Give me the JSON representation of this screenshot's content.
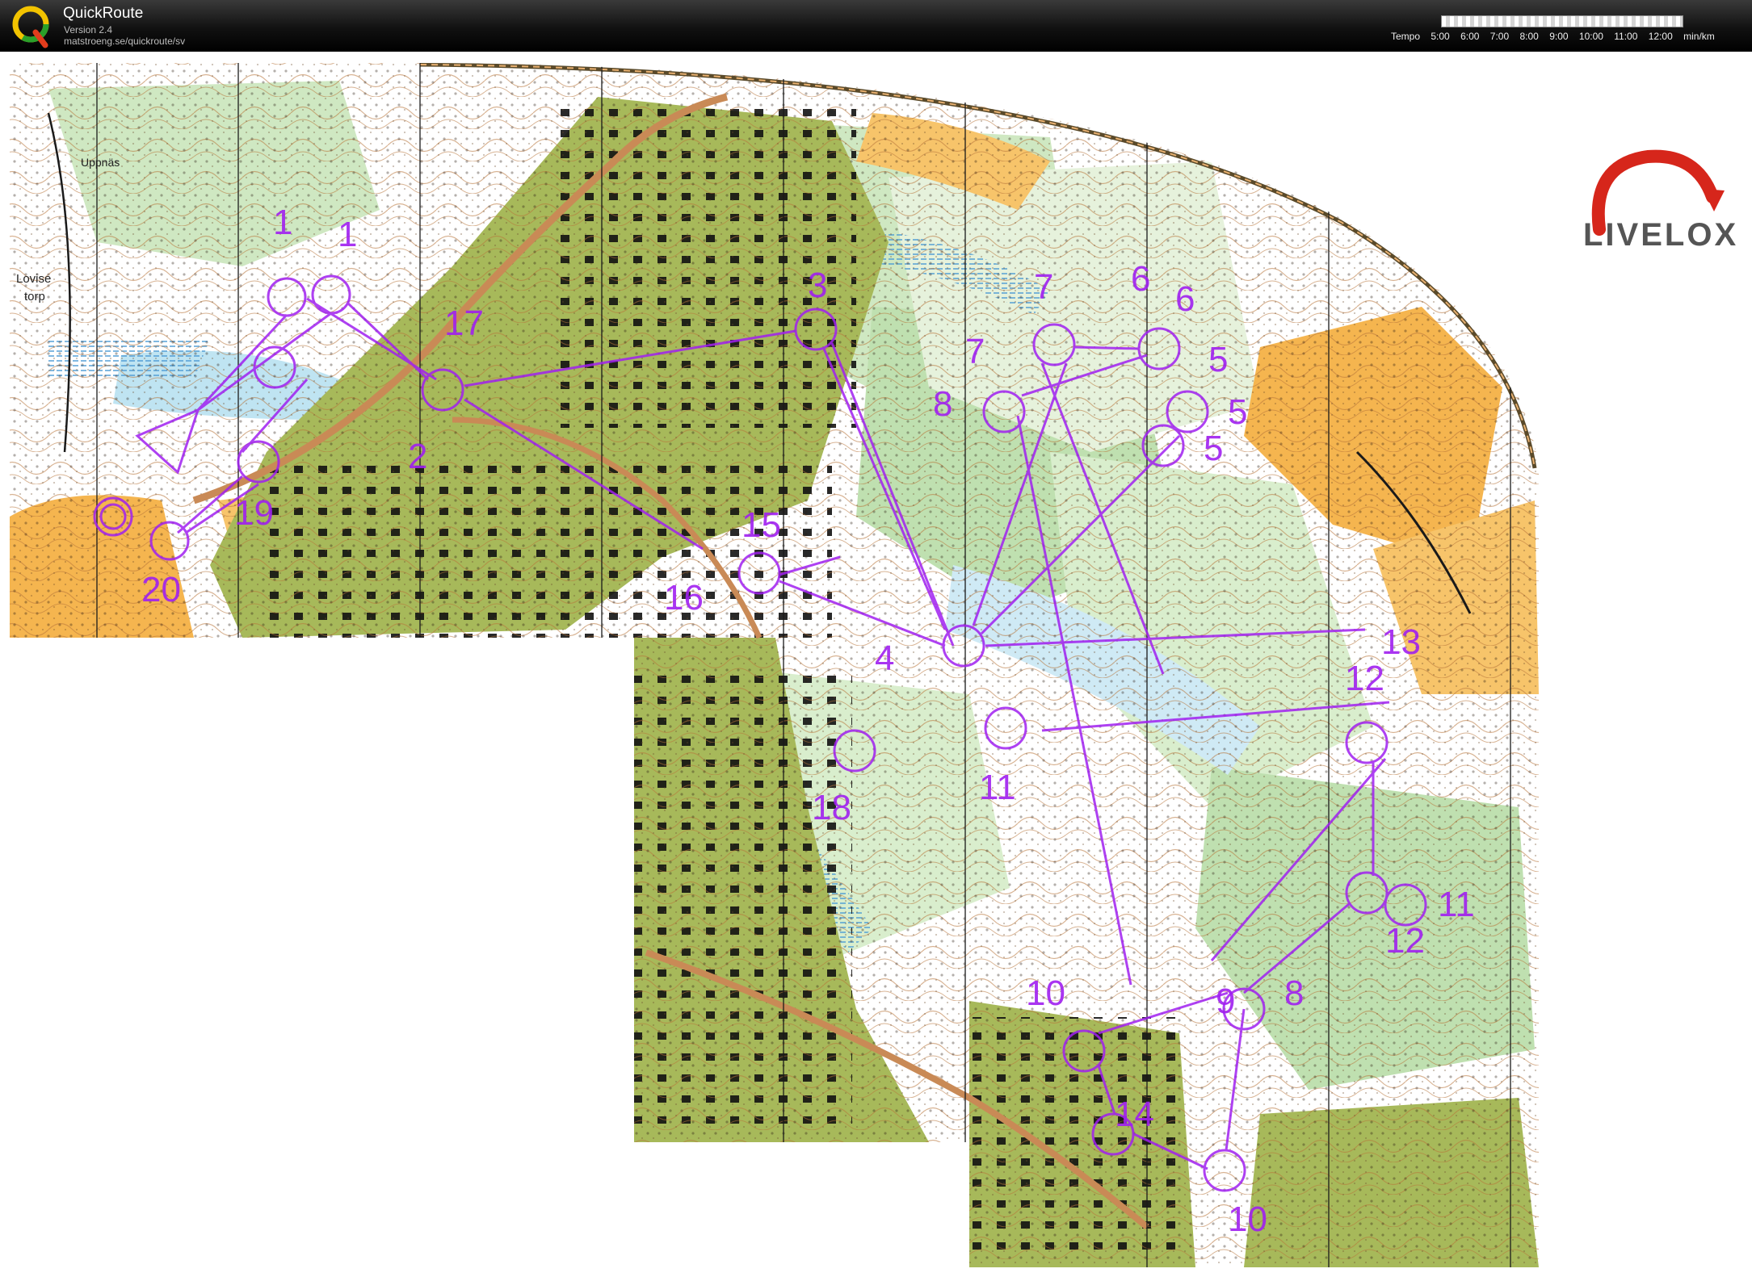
{
  "app": {
    "title": "QuickRoute",
    "version": "Version 2.4",
    "url": "matstroeng.se/quickroute/sv",
    "logo_icon": "quickroute-q-icon"
  },
  "pace_legend": {
    "label": "Tempo",
    "ticks": [
      "5:00",
      "6:00",
      "7:00",
      "8:00",
      "9:00",
      "10:00",
      "11:00",
      "12:00"
    ],
    "unit": "min/km"
  },
  "brand": {
    "name": "LIVELOX",
    "icon": "livelox-arc-icon",
    "color": "#d6261b"
  },
  "map": {
    "place_names": [
      "Uppnäs",
      "Lovise",
      "torp"
    ],
    "course_color": "#a020f0",
    "control_labels": [
      "1",
      "1",
      "2",
      "3",
      "4",
      "5",
      "5",
      "5",
      "6",
      "6",
      "7",
      "7",
      "8",
      "8",
      "9",
      "10",
      "10",
      "11",
      "11",
      "12",
      "12",
      "13",
      "14",
      "15",
      "16",
      "17",
      "18",
      "19",
      "20"
    ]
  }
}
